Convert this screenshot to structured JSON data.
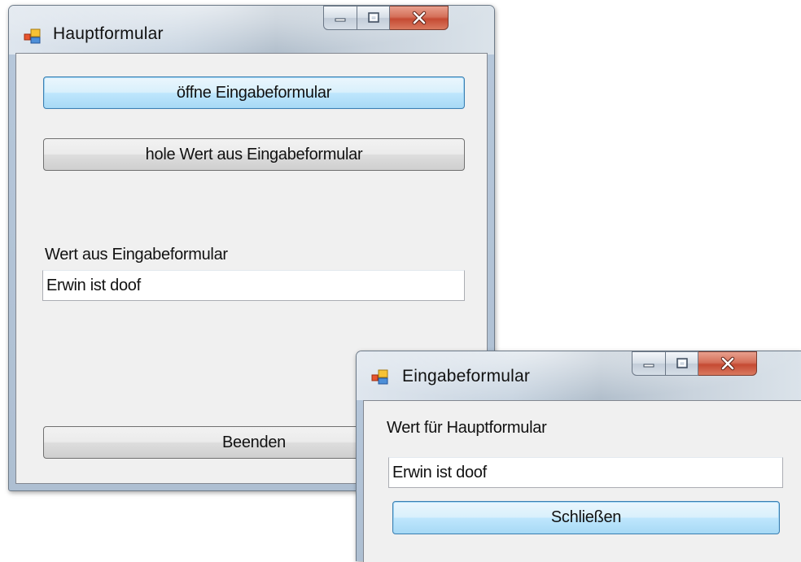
{
  "main_form": {
    "title": "Hauptformular",
    "open_button": "öffne Eingabeformular",
    "fetch_button": "hole Wert aus Eingabeformular",
    "value_label": "Wert aus Eingabeformular",
    "value_field": "Erwin ist doof",
    "exit_button": "Beenden"
  },
  "input_form": {
    "title": "Eingabeformular",
    "value_label": "Wert für Hauptformular",
    "value_field": "Erwin ist doof",
    "close_button": "Schließen"
  },
  "caption_buttons": {
    "minimize_icon": "minimize-icon",
    "maximize_icon": "maximize-icon",
    "close_icon": "close-icon"
  }
}
